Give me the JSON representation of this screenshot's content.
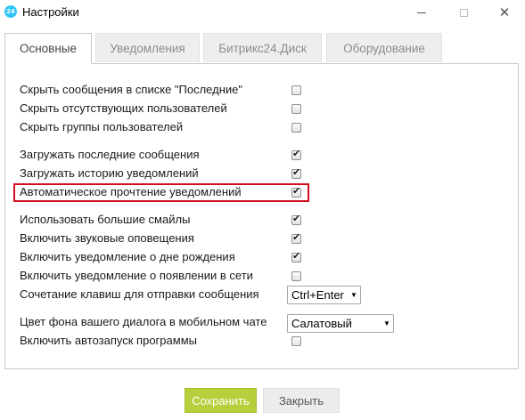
{
  "window": {
    "title": "Настройки",
    "app_icon_text": "24"
  },
  "tabs": [
    {
      "label": "Основные",
      "active": true
    },
    {
      "label": "Уведомления",
      "active": false
    },
    {
      "label": "Битрикс24.Диск",
      "active": false
    },
    {
      "label": "Оборудование",
      "active": false
    }
  ],
  "settings": [
    {
      "label": "Скрыть сообщения в списке \"Последние\"",
      "checked": false
    },
    {
      "label": "Скрыть отсутствующих пользователей",
      "checked": false
    },
    {
      "label": "Скрыть группы пользователей",
      "checked": false
    },
    {
      "label": "Загружать последние сообщения",
      "checked": true
    },
    {
      "label": "Загружать историю уведомлений",
      "checked": true
    },
    {
      "label": "Автоматическое прочтение уведомлений",
      "checked": true,
      "highlighted": true
    },
    {
      "label": "Использовать большие смайлы",
      "checked": true
    },
    {
      "label": "Включить звуковые оповещения",
      "checked": true
    },
    {
      "label": "Включить уведомление о дне рождения",
      "checked": true
    },
    {
      "label": "Включить уведомление о появлении в сети",
      "checked": false
    },
    {
      "label": "Включить автозапуск программы",
      "checked": false
    }
  ],
  "send_shortcut": {
    "label": "Сочетание клавиш для отправки сообщения",
    "value": "Ctrl+Enter"
  },
  "mobile_bg": {
    "label": "Цвет фона вашего диалога в мобильном чате",
    "value": "Салатовый"
  },
  "buttons": {
    "save": "Сохранить",
    "close": "Закрыть"
  },
  "colors": {
    "save_button": "#b6cf3c",
    "highlight_border": "#d10d1e",
    "app_icon": "#2fc6f6"
  }
}
